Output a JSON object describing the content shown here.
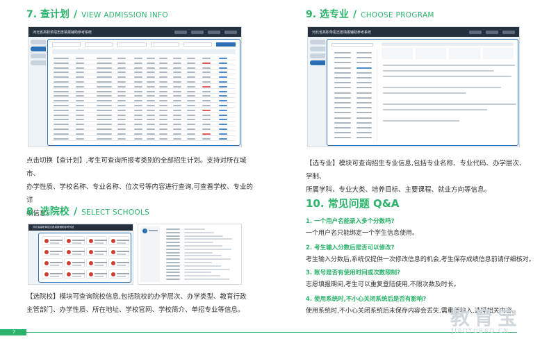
{
  "sections": {
    "s7": {
      "num": "7. 查计划",
      "en": "VIEW ADMISSION INFO",
      "desc": [
        "点击切换【查计划】,考生可查询所报考类别的全部招生计划。支持对所在城市、",
        "办学性质、学校名称、专业名称、位次号等内容进行查询,可查看学校、专业的详",
        "细信息。"
      ]
    },
    "s8": {
      "num": "8. 选院校",
      "en": "SELECT SCHOOLS",
      "desc": [
        "【选院校】模块可查询院校信息,包括院校的办学层次、办学类型、教育行政",
        "主管部门、办学性质、所在地址、学校官网、学校简介、单招专业等信息。"
      ]
    },
    "s9": {
      "num": "9. 选专业",
      "en": "CHOOSE PROGRAM",
      "desc": [
        "【选专业】模块可查询招生专业信息,包括专业名称、专业代码、办学层次、学制、",
        "所属学科、专业大类、培养目标、主要课程、就业方向等信息。"
      ]
    }
  },
  "screenshots": {
    "app_title": "河北省高职单招志愿填报辅助参考系统"
  },
  "qa": {
    "title": "10. 常见问题 Q&A",
    "items": [
      {
        "q": "1. 一个用户名能录入多个分数吗?",
        "a": "一个用户名只能绑定一个学生信息使用。"
      },
      {
        "q": "2. 考生输入分数后是否可以修改?",
        "a": "考生输入分数后,系统仅提供一次修改信息的机会,考生保存成绩信息前请仔细核对。"
      },
      {
        "q": "3. 账号是否有使用时间或次数限制?",
        "a": "志愿填报期间,考生可以重复登陆使用,不限次数及时长。"
      },
      {
        "q": "4. 使用系统时,不小心关闭系统后是否有影响?",
        "a": "使用系统时,不小心关闭系统后未保存内容会丢失,需重新输入,选择相关内容。"
      }
    ]
  },
  "footer": {
    "page": "7"
  },
  "watermark": {
    "cn": "教育宝",
    "en": "JIAOYUBAO.CN"
  },
  "colors": {
    "accent": "#2bb36b",
    "nav": "#25303d",
    "blue": "#2c6fb5"
  }
}
